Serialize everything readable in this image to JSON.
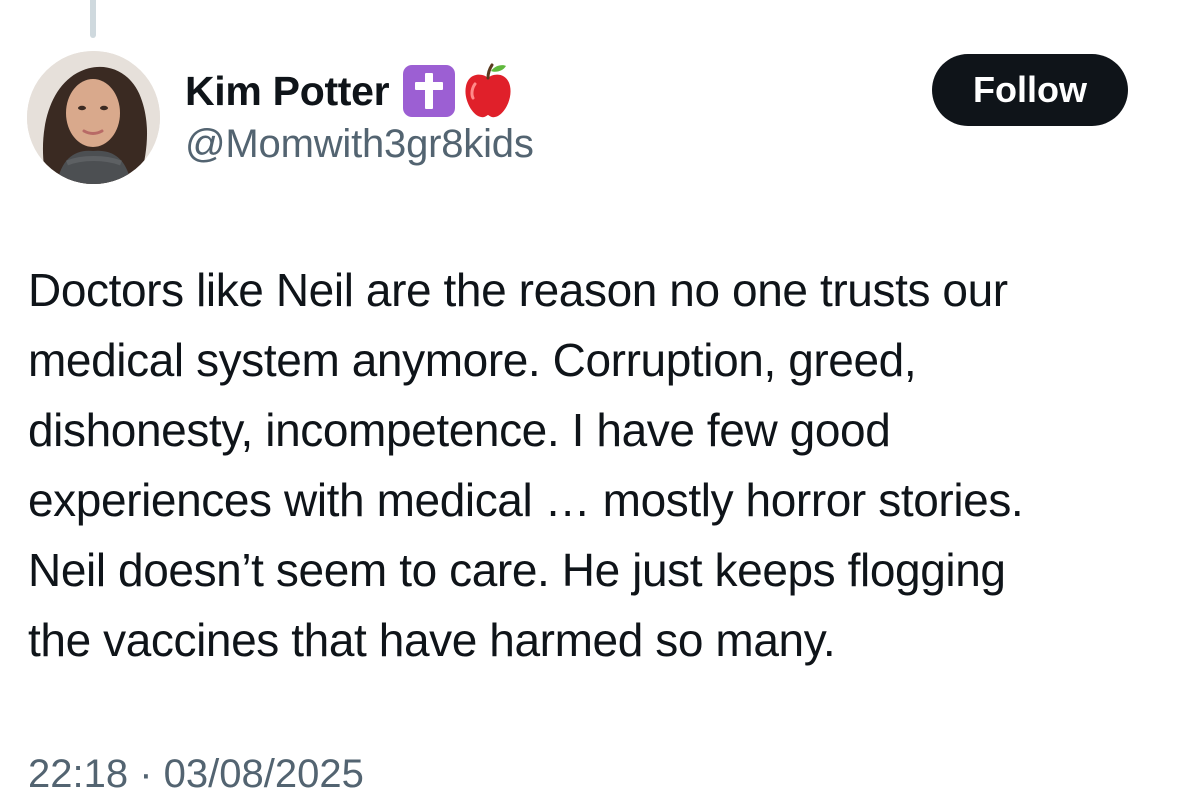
{
  "user": {
    "display_name": "Kim Potter",
    "handle": "@Momwith3gr8kids",
    "badges": [
      "latin-cross-emoji-icon",
      "red-apple-emoji-icon"
    ]
  },
  "actions": {
    "follow_label": "Follow"
  },
  "tweet": {
    "text": "Doctors like Neil are the reason no one trusts our\nmedical system anymore. Corruption, greed,\ndishonesty, incompetence. I have few good\nexperiences with medical … mostly horror stories.\nNeil doesn’t seem to care. He just keeps flogging\nthe vaccines that have harmed so many.",
    "timestamp": "22:18 · 03/08/2025"
  },
  "colors": {
    "follow_bg": "#0f1419",
    "handle_gray": "#536471",
    "cross_badge_purple": "#9c5fd3",
    "apple_red": "#e0202a"
  }
}
